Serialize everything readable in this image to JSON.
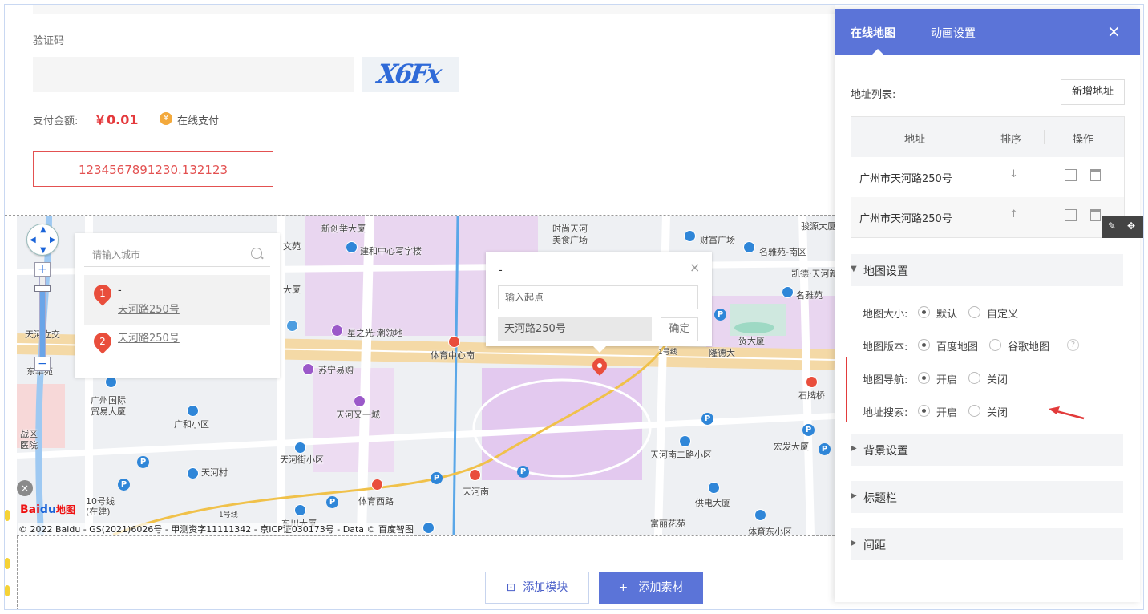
{
  "form": {
    "verify_label": "验证码",
    "captcha_text": "X6Fx",
    "pay_label": "支付金额:",
    "pay_amount": "￥0.01",
    "coin_icon": "¥",
    "pay_method": "在线支付",
    "code_value": "1234567891230.132123"
  },
  "map": {
    "labels": [
      "新创举大厦",
      "时尚天河",
      "美食广场",
      "骏源大厦",
      "文苑",
      "建和中心写字楼",
      "财富广场",
      "名雅苑-南区",
      "大厦",
      "凯德·天河新",
      "名雅苑",
      "星之光·潮领地",
      "天河立交",
      "东华苑",
      "体育中心南",
      "1号线",
      "隆德大",
      "贺大厦",
      "石牌桥",
      "苏宁易购",
      "天河又一城",
      "广州国际",
      "贸易大厦",
      "广和小区",
      "天河街小区",
      "天河南二路小区",
      "宏发大厦",
      "天河村",
      "战区",
      "医院",
      "10号线",
      "(在建)",
      "东川大厦",
      "体育西路",
      "天河南",
      "供电大厦",
      "富丽花苑",
      "体育东小区",
      "1号线"
    ],
    "copyright": "© 2022 Baidu - GS(2021)6026号 - 甲测资字11111342 - 京ICP证030173号 - Data © 百度智图",
    "logo_a": "Bai",
    "logo_b": "du",
    "logo_c": "地图",
    "zoom_in": "+",
    "zoom_out": "−",
    "close_glyph": "×",
    "city_placeholder": "请输入城市",
    "results": [
      {
        "num": "1",
        "title": "-",
        "addr": "天河路250号"
      },
      {
        "num": "2",
        "title": "",
        "addr": "天河路250号"
      }
    ],
    "nav_title": "-",
    "nav_close": "×",
    "nav_start_placeholder": "输入起点",
    "nav_dest": "天河路250号",
    "nav_confirm": "确定"
  },
  "bottom": {
    "add_module_icon": "⊡",
    "add_module": "添加模块",
    "add_material_icon": "+",
    "add_material": "添加素材"
  },
  "panel": {
    "tabs": [
      "在线地图",
      "动画设置"
    ],
    "close": "×",
    "address_list_label": "地址列表:",
    "new_address": "新增地址",
    "columns": [
      "地址",
      "排序",
      "操作"
    ],
    "rows": [
      {
        "address": "广州市天河路250号",
        "sort_icon": "↓"
      },
      {
        "address": "广州市天河路250号",
        "sort_icon": "↑"
      }
    ],
    "float_icons": [
      "✎",
      "✥"
    ],
    "map_settings": "地图设置",
    "size_label": "地图大小:",
    "size_options": [
      "默认",
      "自定义"
    ],
    "version_label": "地图版本:",
    "version_options": [
      "百度地图",
      "谷歌地图"
    ],
    "help": "?",
    "nav_label": "地图导航:",
    "nav_options": [
      "开启",
      "关闭"
    ],
    "search_label": "地址搜索:",
    "search_options": [
      "开启",
      "关闭"
    ],
    "sections": [
      "背景设置",
      "标题栏",
      "间距"
    ],
    "expand_open": "▼",
    "expand_closed": "▶"
  },
  "colors": {
    "accent": "#5b74d8",
    "price": "#e4393c",
    "highlight": "#e23b3b"
  }
}
